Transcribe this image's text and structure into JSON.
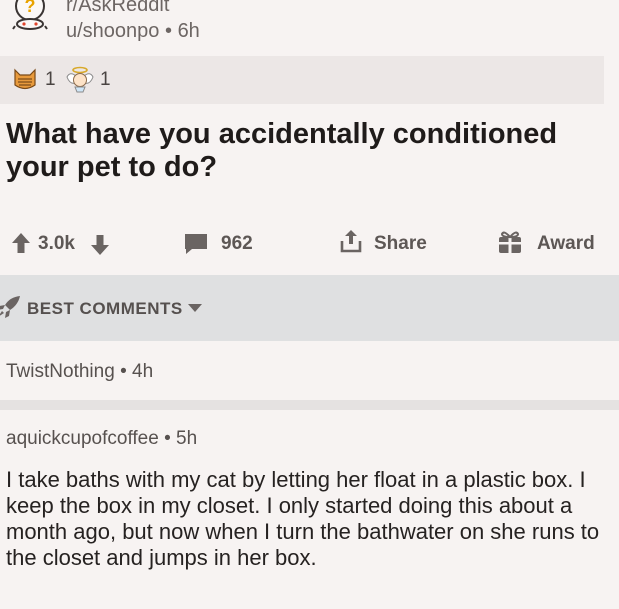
{
  "header": {
    "subreddit": "r/AskReddit",
    "author": "u/shoonpo",
    "age": "6h",
    "separator": "•"
  },
  "awards": [
    {
      "icon": "cat-face-award-icon",
      "count": "1"
    },
    {
      "icon": "angel-award-icon",
      "count": "1"
    }
  ],
  "post": {
    "title": "What have you accidentally conditioned your pet to do?"
  },
  "actions": {
    "votes": "3.0k",
    "comments": "962",
    "share": "Share",
    "award": "Award"
  },
  "sort": {
    "label": "BEST COMMENTS"
  },
  "comments": [
    {
      "author": "TwistNothing",
      "age": "4h"
    },
    {
      "author": "aquickcupofcoffee",
      "age": "5h",
      "body": "I take baths with my cat by letting her float in a plastic box. I keep the box in my closet. I only started doing this about a month ago, but now when I turn the bathwater on she runs to the closet and jumps in her box."
    }
  ],
  "colors": {
    "background": "#f7f3f2",
    "awards_bg": "#ece7e6",
    "sort_bg": "#dfe0e1",
    "text": "#262221",
    "muted": "#6d6664"
  }
}
